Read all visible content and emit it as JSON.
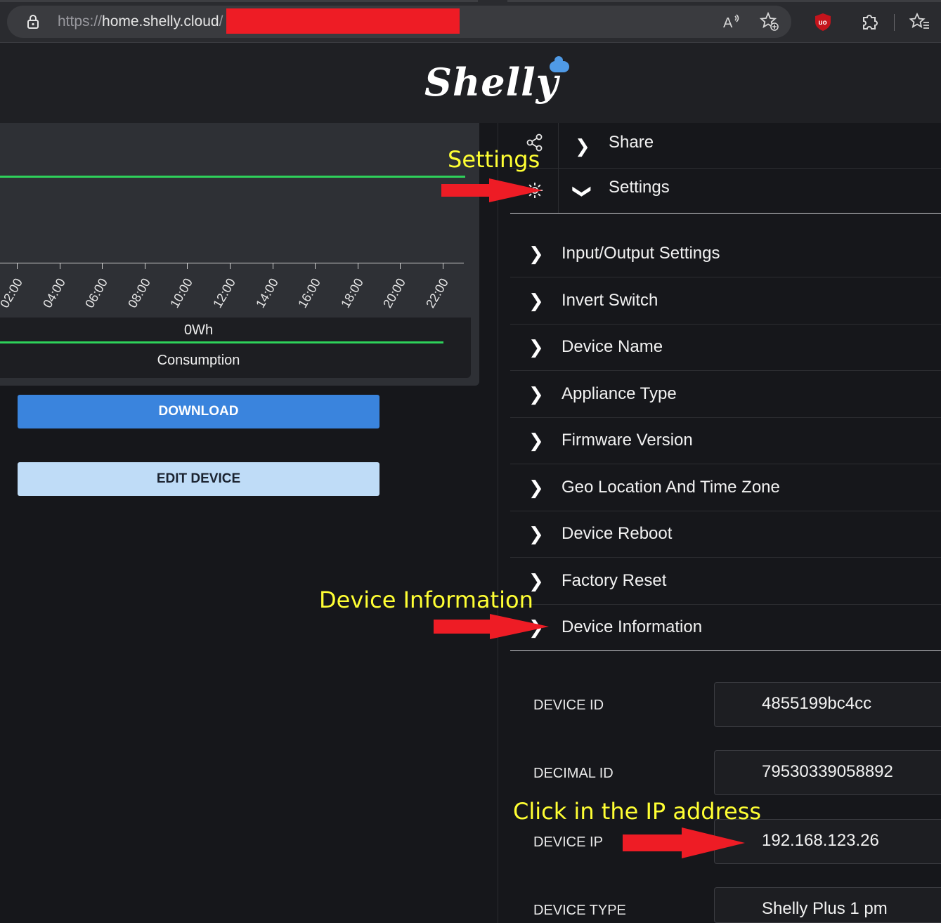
{
  "browser": {
    "url_scheme": "https://",
    "url_host": "home.shelly.cloud",
    "url_path": "/",
    "icons": [
      "lock-icon",
      "read-aloud-icon",
      "add-favorite-icon",
      "ublock-icon",
      "extensions-icon",
      "favorites-icon"
    ]
  },
  "header": {
    "logo_text": "Shelly"
  },
  "chart": {
    "ticks": [
      "02:00",
      "04:00",
      "06:00",
      "08:00",
      "10:00",
      "12:00",
      "14:00",
      "16:00",
      "18:00",
      "20:00",
      "22:00"
    ],
    "legend_value": "0Wh",
    "legend_label": "Consumption",
    "line_color": "#2ed15a"
  },
  "buttons": {
    "download": "DOWNLOAD",
    "edit_device": "EDIT DEVICE"
  },
  "panel": {
    "share": "Share",
    "settings": "Settings",
    "menu": [
      "Input/Output Settings",
      "Invert Switch",
      "Device Name",
      "Appliance Type",
      "Firmware Version",
      "Geo Location And Time Zone",
      "Device Reboot",
      "Factory Reset",
      "Device Information"
    ]
  },
  "device_info": {
    "device_id_label": "DEVICE ID",
    "device_id": "4855199bc4cc",
    "decimal_id_label": "DECIMAL ID",
    "decimal_id": "79530339058892",
    "device_ip_label": "DEVICE IP",
    "device_ip": "192.168.123.26",
    "device_type_label": "DEVICE TYPE",
    "device_type": "Shelly Plus 1 pm"
  },
  "annotations": {
    "settings": "Settings",
    "device_information": "Device Information",
    "click_ip": "Click in the IP address",
    "color": "#ffff33",
    "arrow_color": "#ee1c25"
  }
}
